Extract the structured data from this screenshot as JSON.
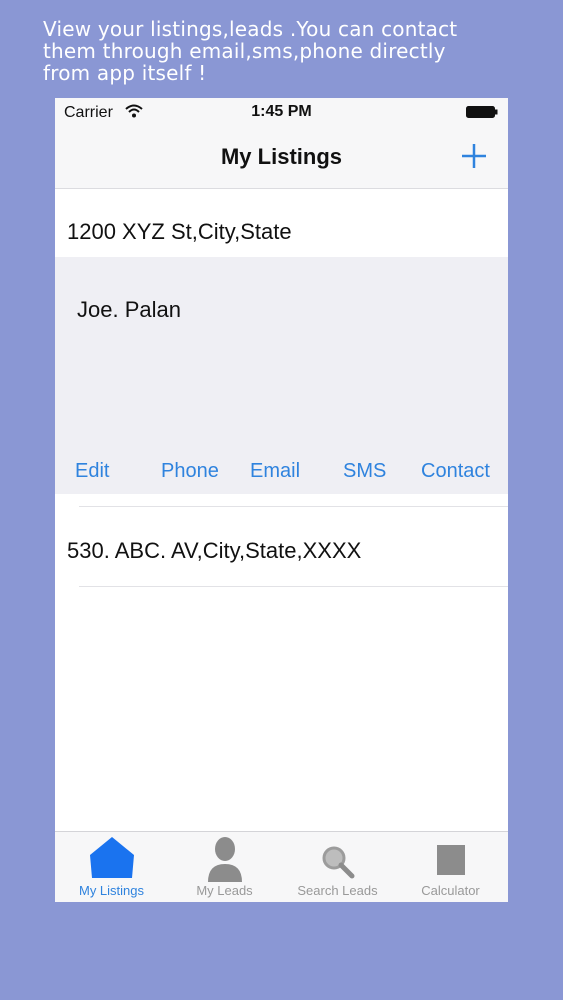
{
  "promo": {
    "line1": "View your listings,leads .You can contact",
    "line2": "them through email,sms,phone directly",
    "line3": "from app itself !"
  },
  "status_bar": {
    "carrier": "Carrier",
    "time": "1:45 PM"
  },
  "nav": {
    "title": "My Listings",
    "add_icon": "plus-icon"
  },
  "listings": [
    {
      "address": "1200 XYZ St,City,State",
      "contact_name": "Joe. Palan",
      "actions": [
        "Edit",
        "Phone",
        "Email",
        "SMS",
        "Contact"
      ]
    },
    {
      "address": "530. ABC. AV,City,State,XXXX"
    }
  ],
  "tabs": [
    {
      "label": "My Listings",
      "icon": "house-icon",
      "active": true
    },
    {
      "label": "My Leads",
      "icon": "person-icon",
      "active": false
    },
    {
      "label": "Search Leads",
      "icon": "magnifier-icon",
      "active": false
    },
    {
      "label": "Calculator",
      "icon": "calculator-icon",
      "active": false
    }
  ],
  "colors": {
    "background": "#8a97d4",
    "accent": "#2f83de",
    "expanded_row": "#efeff4",
    "inactive_tab": "#999999"
  }
}
